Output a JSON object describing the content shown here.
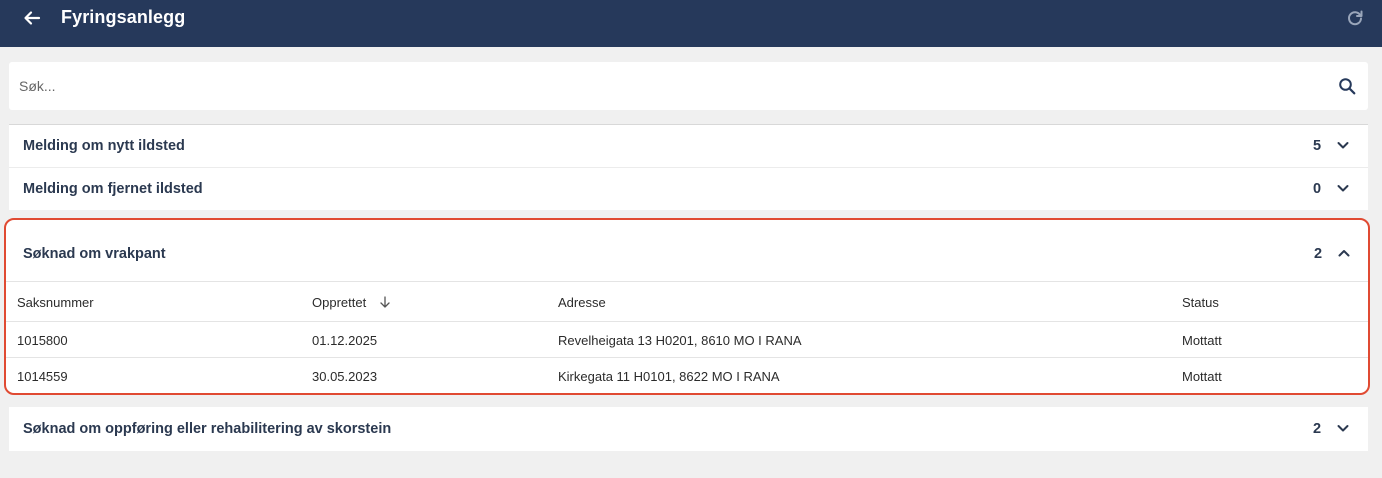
{
  "header": {
    "title": "Fyringsanlegg",
    "bg_color": "#26395b"
  },
  "search": {
    "placeholder": "Søk...",
    "value": ""
  },
  "sections": [
    {
      "title": "Melding om nytt ildsted",
      "count": "5",
      "expanded": false
    },
    {
      "title": "Melding om fjernet ildsted",
      "count": "0",
      "expanded": false
    }
  ],
  "expanded_section": {
    "title": "Søknad om vrakpant",
    "count": "2",
    "expanded": true,
    "highlight_color": "#e04a32",
    "table": {
      "columns": [
        "Saksnummer",
        "Opprettet",
        "Adresse",
        "Status"
      ],
      "sorted_column": "Opprettet",
      "sort_direction": "descending",
      "rows": [
        [
          "1015800",
          "01.12.2025",
          "Revelheigata 13 H0201, 8610 MO I RANA",
          "Mottatt"
        ],
        [
          "1014559",
          "30.05.2023",
          "Kirkegata 11 H0101, 8622 MO I RANA",
          "Mottatt"
        ]
      ]
    }
  },
  "last_section": {
    "title": "Søknad om oppføring eller rehabilitering av skorstein",
    "count": "2",
    "expanded": false
  },
  "icons": {
    "back": "arrow-left-icon",
    "refresh": "refresh-icon",
    "search": "search-icon",
    "expand": "chevron-down-icon",
    "collapse": "chevron-up-icon",
    "sort": "arrow-down-icon"
  }
}
